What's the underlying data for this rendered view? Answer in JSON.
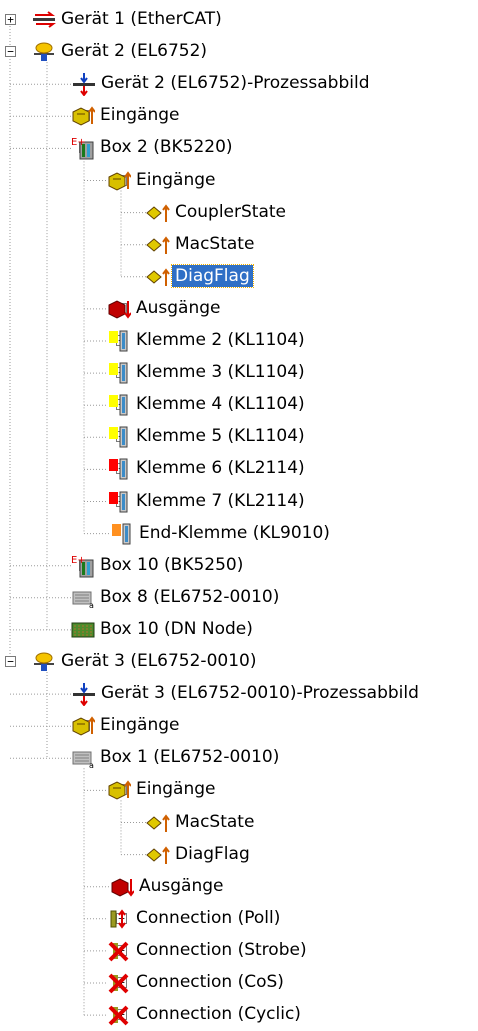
{
  "tree": {
    "nodes": [
      {
        "label": "Gerät 1 (EtherCAT)",
        "icon": "ethercat-device-icon",
        "level": 0,
        "expander": "+"
      },
      {
        "label": "Gerät 2 (EL6752)",
        "icon": "device-controller-icon",
        "level": 0,
        "expander": "-"
      },
      {
        "label": "Gerät 2 (EL6752)-Prozessabbild",
        "icon": "process-image-icon",
        "level": 1,
        "expander": ""
      },
      {
        "label": "Eingänge",
        "icon": "inputs-icon",
        "level": 1,
        "expander": "+"
      },
      {
        "label": "Box 2  (BK5220)",
        "icon": "bus-coupler-icon",
        "level": 1,
        "expander": "-"
      },
      {
        "label": "Eingänge",
        "icon": "inputs-icon",
        "level": 2,
        "expander": "-"
      },
      {
        "label": "CouplerState",
        "icon": "input-variable-icon",
        "level": 3,
        "expander": ""
      },
      {
        "label": "MacState",
        "icon": "input-variable-icon",
        "level": 3,
        "expander": ""
      },
      {
        "label": "DiagFlag",
        "icon": "input-variable-icon",
        "level": 3,
        "expander": "",
        "selected": true
      },
      {
        "label": "Ausgänge",
        "icon": "outputs-icon",
        "level": 2,
        "expander": "+"
      },
      {
        "label": "Klemme 2 (KL1104)",
        "icon": "terminal-yellow-icon",
        "level": 2,
        "expander": "+"
      },
      {
        "label": "Klemme 3 (KL1104)",
        "icon": "terminal-yellow-icon",
        "level": 2,
        "expander": "+"
      },
      {
        "label": "Klemme 4 (KL1104)",
        "icon": "terminal-yellow-icon",
        "level": 2,
        "expander": "+"
      },
      {
        "label": "Klemme 5 (KL1104)",
        "icon": "terminal-yellow-icon",
        "level": 2,
        "expander": "+"
      },
      {
        "label": "Klemme 6 (KL2114)",
        "icon": "terminal-red-icon",
        "level": 2,
        "expander": "+"
      },
      {
        "label": "Klemme 7 (KL2114)",
        "icon": "terminal-red-icon",
        "level": 2,
        "expander": "+"
      },
      {
        "label": "End-Klemme (KL9010)",
        "icon": "terminal-orange-icon",
        "level": 2,
        "expander": ""
      },
      {
        "label": "Box 10  (BK5250)",
        "icon": "bus-coupler-icon",
        "level": 1,
        "expander": "+"
      },
      {
        "label": "Box 8 (EL6752-0010)",
        "icon": "box-module-icon",
        "level": 1,
        "expander": "+"
      },
      {
        "label": "Box 10 (DN Node)",
        "icon": "dn-node-icon",
        "level": 1,
        "expander": "+"
      },
      {
        "label": "Gerät 3 (EL6752-0010)",
        "icon": "device-controller-icon",
        "level": 0,
        "expander": "-"
      },
      {
        "label": "Gerät 3 (EL6752-0010)-Prozessabbild",
        "icon": "process-image-icon",
        "level": 1,
        "expander": ""
      },
      {
        "label": "Eingänge",
        "icon": "inputs-icon",
        "level": 1,
        "expander": "+"
      },
      {
        "label": "Box 1 (EL6752-0010)",
        "icon": "box-module-icon",
        "level": 1,
        "expander": "-"
      },
      {
        "label": "Eingänge",
        "icon": "inputs-icon",
        "level": 2,
        "expander": "-"
      },
      {
        "label": "MacState",
        "icon": "input-variable-icon",
        "level": 3,
        "expander": ""
      },
      {
        "label": "DiagFlag",
        "icon": "input-variable-icon",
        "level": 3,
        "expander": ""
      },
      {
        "label": "Ausgänge",
        "icon": "outputs-icon",
        "level": 2,
        "expander": ""
      },
      {
        "label": "Connection (Poll)",
        "icon": "connection-poll-icon",
        "level": 2,
        "expander": "+"
      },
      {
        "label": "Connection (Strobe)",
        "icon": "connection-disabled-icon",
        "level": 2,
        "expander": "+"
      },
      {
        "label": "Connection (CoS)",
        "icon": "connection-disabled-icon",
        "level": 2,
        "expander": "+"
      },
      {
        "label": "Connection (Cyclic)",
        "icon": "connection-disabled-icon",
        "level": 2,
        "expander": "+"
      }
    ]
  },
  "colors": {
    "selection": "#2f6fc6",
    "terminal_yellow": "#ffff00",
    "terminal_red": "#ff0000",
    "terminal_orange": "#ff9020",
    "disabled_x": "#e00000"
  }
}
